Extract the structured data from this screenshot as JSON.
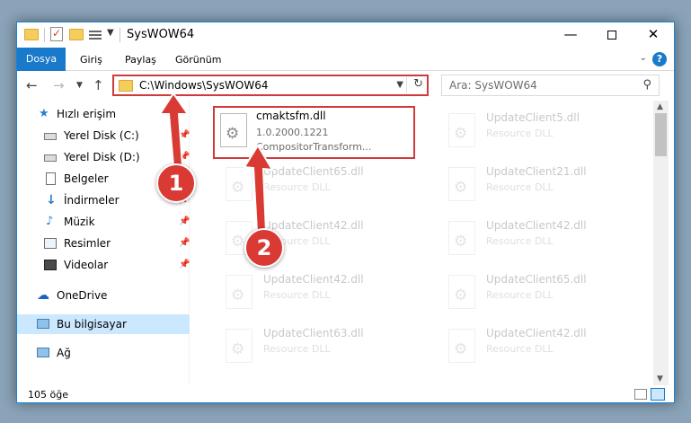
{
  "window": {
    "title": "SysWOW64",
    "controls": {
      "minimize": "—",
      "maximize": "",
      "close": "✕"
    }
  },
  "ribbon": {
    "tabs": [
      {
        "label": "Dosya",
        "active": true
      },
      {
        "label": "Giriş"
      },
      {
        "label": "Paylaş"
      },
      {
        "label": "Görünüm"
      }
    ],
    "help": "?"
  },
  "navigation": {
    "address": "C:\\Windows\\SysWOW64",
    "search_placeholder": "Ara: SysWOW64"
  },
  "sidebar": {
    "items": [
      {
        "label": "Hızlı erişim",
        "icon": "star-icon"
      },
      {
        "label": "Yerel Disk (C:)",
        "icon": "drive-icon",
        "pinned": true
      },
      {
        "label": "Yerel Disk (D:)",
        "icon": "drive-icon",
        "pinned": true
      },
      {
        "label": "Belgeler",
        "icon": "document-icon",
        "pinned": true
      },
      {
        "label": "İndirmeler",
        "icon": "download-icon",
        "pinned": true
      },
      {
        "label": "Müzik",
        "icon": "music-icon",
        "pinned": true
      },
      {
        "label": "Resimler",
        "icon": "pictures-icon",
        "pinned": true
      },
      {
        "label": "Videolar",
        "icon": "videos-icon",
        "pinned": true
      },
      {
        "label": "OneDrive",
        "icon": "onedrive-icon"
      },
      {
        "label": "Bu bilgisayar",
        "icon": "computer-icon",
        "selected": true
      },
      {
        "label": "Ağ",
        "icon": "network-icon"
      }
    ]
  },
  "files": [
    {
      "name": "cmaktsfm.dll",
      "line1": "1.0.2000.1221",
      "line2": "CompositorTransform...",
      "selected": true
    },
    {
      "name": "UpdateClient5.dll",
      "line1": "Resource DLL"
    },
    {
      "name": "UpdateClient65.dll",
      "line1": "Resource DLL"
    },
    {
      "name": "UpdateClient21.dll",
      "line1": "Resource DLL"
    },
    {
      "name": "UpdateClient42.dll",
      "line1": "Resource DLL"
    },
    {
      "name": "UpdateClient42.dll",
      "line1": "Resource DLL"
    },
    {
      "name": "UpdateClient42.dll",
      "line1": "Resource DLL"
    },
    {
      "name": "UpdateClient65.dll",
      "line1": "Resource DLL"
    },
    {
      "name": "UpdateClient63.dll",
      "line1": "Resource DLL"
    },
    {
      "name": "UpdateClient42.dll",
      "line1": "Resource DLL"
    }
  ],
  "status": {
    "item_count": "105 öğe"
  },
  "annotations": {
    "badge1": "1",
    "badge2": "2",
    "color": "#d93a33"
  }
}
